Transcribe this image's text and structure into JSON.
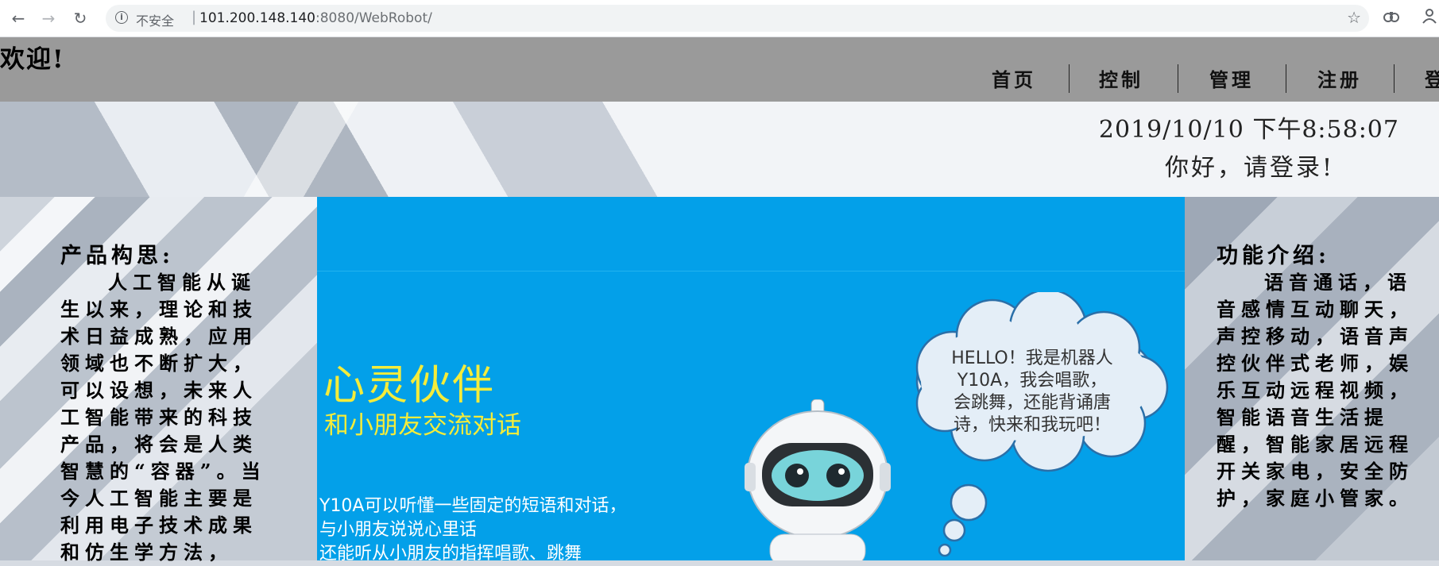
{
  "browser": {
    "back": "←",
    "forward": "→",
    "reload": "↻",
    "info_icon": "i",
    "insecure_label": "不安全",
    "separator": "|",
    "url_host": "101.200.148.140",
    "url_port_path": ":8080/WebRobot/",
    "star": "☆"
  },
  "header": {
    "welcome": "欢迎!",
    "nav": [
      {
        "label": "首页"
      },
      {
        "label": "控制"
      },
      {
        "label": "管理"
      },
      {
        "label": "注册"
      },
      {
        "label": "登"
      }
    ]
  },
  "banner": {
    "datetime": "2019/10/10 下午8:58:07",
    "login_prompt": "你好，请登录!"
  },
  "left_panel": {
    "title": "产品构思:",
    "text": "人工智能从诞生以来，理论和技术日益成熟，应用领域也不断扩大，可以设想，未来人工智能带来的科技产品，将会是人类智慧的“容器”。当今人工智能主要是利用电子技术成果和仿生学方法，"
  },
  "right_panel": {
    "title": "功能介绍:",
    "text": "语音通话，语音感情互动聊天，声控移动，语音声控伙伴式老师，娱乐互动远程视频，智能语音生活提醒，智能家居远程开关家电，安全防护，家庭小管家。"
  },
  "product": {
    "slogan_main": "心灵伙伴",
    "slogan_sub": "和小朋友交流对话",
    "desc_lines": [
      "Y10A可以听懂一些固定的短语和对话，",
      "与小朋友说说心里话",
      "还能听从小朋友的指挥唱歌、跳舞"
    ],
    "bubble_lines": [
      "HELLO！我是机器人",
      "Y10A，我会唱歌，",
      "会跳舞，还能背诵唐",
      "诗，快来和我玩吧！"
    ]
  },
  "colors": {
    "header_bg": "#9a9a9a",
    "product_bg": "#03a0e9",
    "slogan": "#f4ec3a"
  }
}
